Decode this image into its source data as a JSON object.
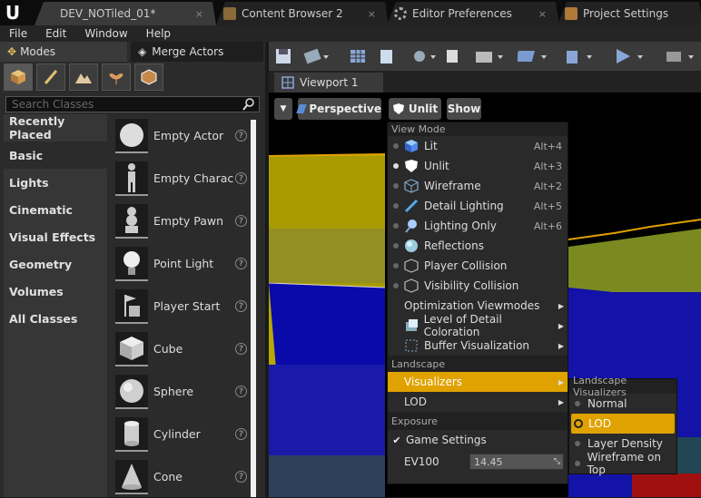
{
  "app": {
    "logo": "U"
  },
  "doc_tabs": [
    {
      "label": "DEV_NOTiled_01*",
      "icon": "level-icon"
    },
    {
      "label": "Content Browser 2",
      "icon": "folder-icon"
    },
    {
      "label": "Editor Preferences",
      "icon": "gear-icon"
    },
    {
      "label": "Project Settings",
      "icon": "settings-icon"
    }
  ],
  "close_glyph": "×",
  "menubar": [
    "File",
    "Edit",
    "Window",
    "Help"
  ],
  "panel_tabs": [
    {
      "label": "Modes"
    },
    {
      "label": "Merge Actors"
    }
  ],
  "search": {
    "placeholder": "Search Classes"
  },
  "categories": [
    "Recently Placed",
    "Basic",
    "Lights",
    "Cinematic",
    "Visual Effects",
    "Geometry",
    "Volumes",
    "All Classes"
  ],
  "selected_category": "Basic",
  "classes": [
    "Empty Actor",
    "Empty Charac",
    "Empty Pawn",
    "Point Light",
    "Player Start",
    "Cube",
    "Sphere",
    "Cylinder",
    "Cone"
  ],
  "help_glyph": "?",
  "viewport_tab": {
    "label": "Viewport 1"
  },
  "viewport_bar": {
    "perspective": "Perspective",
    "view_mode": "Unlit",
    "show": "Show"
  },
  "view_mode_menu": {
    "header": "View Mode",
    "items": [
      {
        "label": "Lit",
        "key": "Alt+4",
        "selected": false
      },
      {
        "label": "Unlit",
        "key": "Alt+3",
        "selected": true
      },
      {
        "label": "Wireframe",
        "key": "Alt+2",
        "selected": false
      },
      {
        "label": "Detail Lighting",
        "key": "Alt+5",
        "selected": false
      },
      {
        "label": "Lighting Only",
        "key": "Alt+6",
        "selected": false
      },
      {
        "label": "Reflections",
        "key": "",
        "selected": false
      },
      {
        "label": "Player Collision",
        "key": "",
        "selected": false
      },
      {
        "label": "Visibility Collision",
        "key": "",
        "selected": false
      }
    ],
    "optimization": "Optimization Viewmodes",
    "lod_coloration": "Level of Detail Coloration",
    "buffer_vis": "Buffer Visualization",
    "landscape_header": "Landscape",
    "visualizers": "Visualizers",
    "lod": "LOD",
    "exposure_header": "Exposure",
    "game_settings": "Game Settings",
    "game_settings_checked": true,
    "ev100_label": "EV100",
    "ev100_value": "14.45"
  },
  "landscape_visualizers": {
    "header": "Landscape Visualizers",
    "items": [
      "Normal",
      "LOD",
      "Layer Density",
      "Wireframe on Top"
    ],
    "selected": "LOD"
  },
  "colors": {
    "accent": "#e0a200",
    "viewport_bg": "#000000",
    "panel_bg": "#2b2b2b"
  }
}
